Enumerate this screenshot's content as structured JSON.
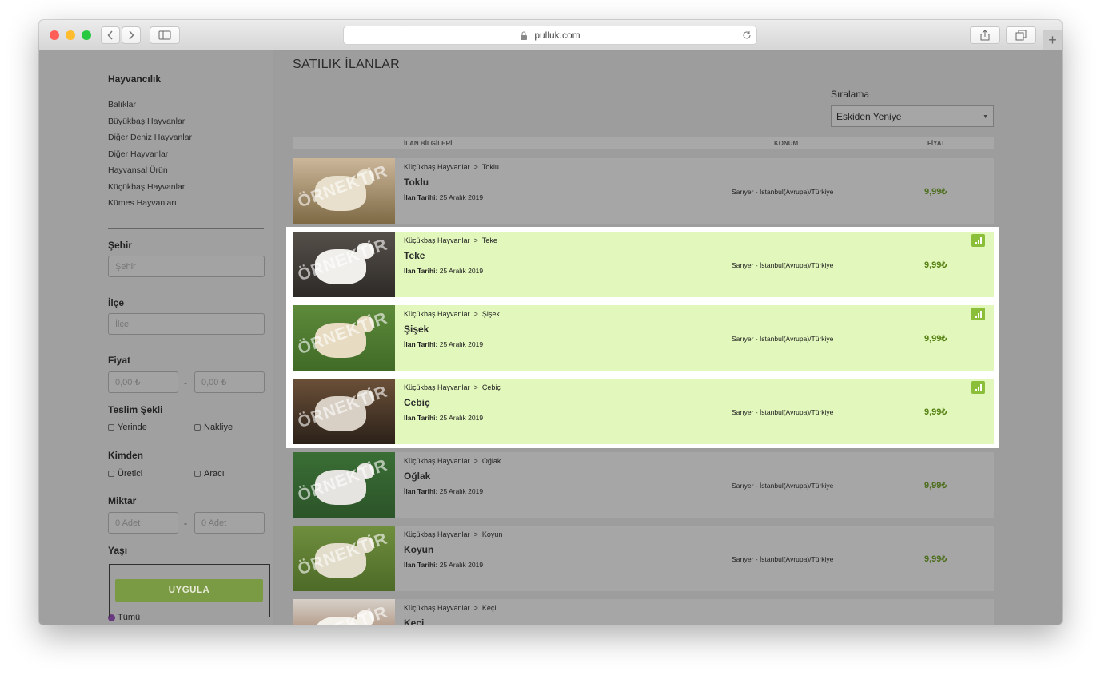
{
  "browser": {
    "url": "pulluk.com",
    "colors": {
      "close": "#ff5f57",
      "minimize": "#febc2e",
      "zoom": "#28c840"
    }
  },
  "sidebar": {
    "category_title": "Hayvancılık",
    "categories": [
      "Balıklar",
      "Büyükbaş Hayvanlar",
      "Diğer Deniz Hayvanları",
      "Diğer Hayvanlar",
      "Hayvansal Ürün",
      "Küçükbaş Hayvanlar",
      "Kümes Hayvanları"
    ],
    "city": {
      "label": "Şehir",
      "placeholder": "Şehir"
    },
    "district": {
      "label": "İlçe",
      "placeholder": "İlçe"
    },
    "price": {
      "label": "Fiyat",
      "min_placeholder": "0,00 ₺",
      "max_placeholder": "0,00 ₺",
      "separator": "-"
    },
    "delivery": {
      "label": "Teslim Şekli",
      "options": [
        "Yerinde",
        "Nakliye"
      ]
    },
    "seller": {
      "label": "Kimden",
      "options": [
        "Üretici",
        "Aracı"
      ]
    },
    "quantity": {
      "label": "Miktar",
      "min_placeholder": "0 Adet",
      "max_placeholder": "0 Adet",
      "separator": "-"
    },
    "age": {
      "label": "Yaşı",
      "option_all": "Tümü"
    },
    "apply_label": "UYGULA"
  },
  "main": {
    "title": "SATILIK İLANLAR",
    "sort": {
      "label": "Sıralama",
      "value": "Eskiden Yeniye"
    },
    "columns": {
      "info": "İLAN BİLGİLERİ",
      "location": "KONUM",
      "price": "FİYAT"
    },
    "watermark": "ÖRNEKTİR",
    "date_label": "İlan Tarihi:",
    "crumb_separator": ">",
    "accent": "#7a9a44",
    "highlight": "#e2f7bb",
    "listings": [
      {
        "category": "Küçükbaş Hayvanlar",
        "sub": "Toklu",
        "name": "Toklu",
        "date": "25 Aralık 2019",
        "location": "Sarıyer - İstanbul(Avrupa)/Türkiye",
        "price": "9,99₺",
        "featured": false
      },
      {
        "category": "Küçükbaş Hayvanlar",
        "sub": "Teke",
        "name": "Teke",
        "date": "25 Aralık 2019",
        "location": "Sarıyer - İstanbul(Avrupa)/Türkiye",
        "price": "9,99₺",
        "featured": true
      },
      {
        "category": "Küçükbaş Hayvanlar",
        "sub": "Şişek",
        "name": "Şişek",
        "date": "25 Aralık 2019",
        "location": "Sarıyer - İstanbul(Avrupa)/Türkiye",
        "price": "9,99₺",
        "featured": true
      },
      {
        "category": "Küçükbaş Hayvanlar",
        "sub": "Çebiç",
        "name": "Cebiç",
        "date": "25 Aralık 2019",
        "location": "Sarıyer - İstanbul(Avrupa)/Türkiye",
        "price": "9,99₺",
        "featured": true
      },
      {
        "category": "Küçükbaş Hayvanlar",
        "sub": "Oğlak",
        "name": "Oğlak",
        "date": "25 Aralık 2019",
        "location": "Sarıyer - İstanbul(Avrupa)/Türkiye",
        "price": "9,99₺",
        "featured": false
      },
      {
        "category": "Küçükbaş Hayvanlar",
        "sub": "Koyun",
        "name": "Koyun",
        "date": "25 Aralık 2019",
        "location": "Sarıyer - İstanbul(Avrupa)/Türkiye",
        "price": "9,99₺",
        "featured": false
      },
      {
        "category": "Küçükbaş Hayvanlar",
        "sub": "Keçi",
        "name": "Keçi",
        "date": "",
        "location": "",
        "price": "",
        "featured": false
      }
    ]
  }
}
